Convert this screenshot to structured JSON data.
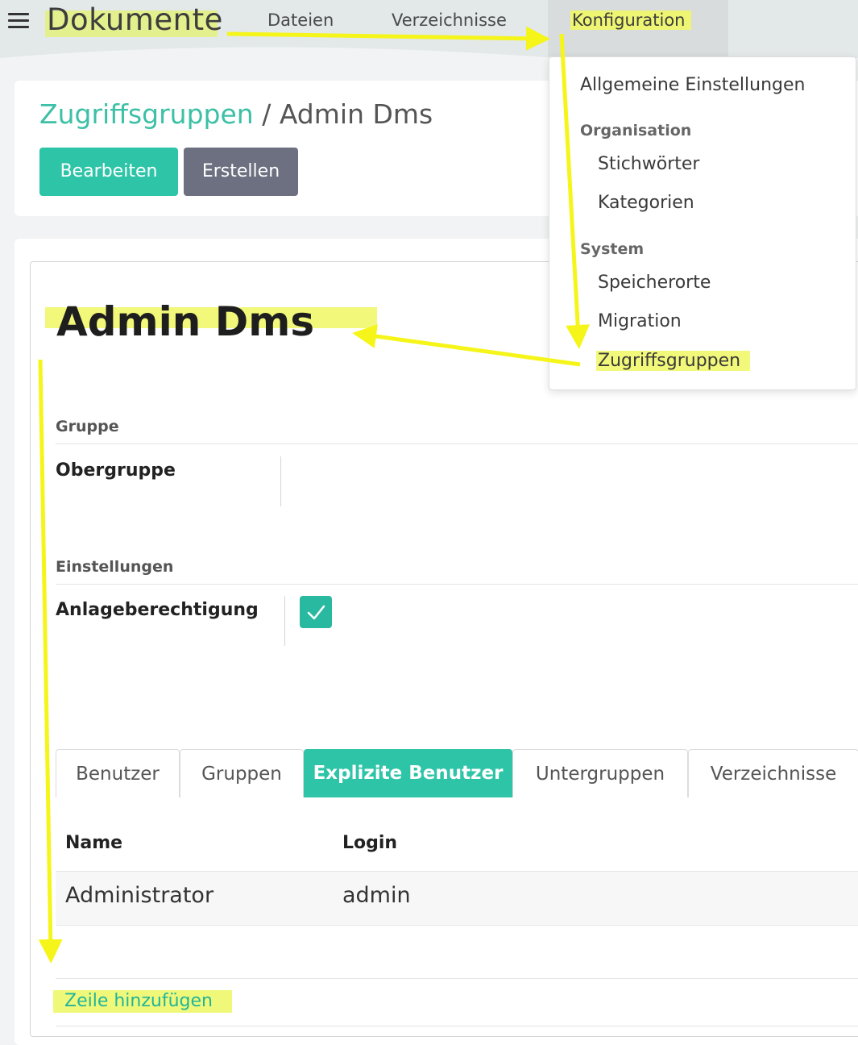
{
  "navbar": {
    "app_title": "Dokumente",
    "items": [
      "Dateien",
      "Verzeichnisse",
      "Konfiguration"
    ]
  },
  "dropdown": {
    "general": "Allgemeine Einstellungen",
    "section_org": "Organisation",
    "org_items": [
      "Stichwörter",
      "Kategorien"
    ],
    "section_system": "System",
    "system_items": [
      "Speicherorte",
      "Migration",
      "Zugriffsgruppen"
    ]
  },
  "breadcrumb": {
    "parent": "Zugriffsgruppen",
    "separator": "/",
    "current": "Admin Dms"
  },
  "buttons": {
    "edit": "Bearbeiten",
    "create": "Erstellen"
  },
  "record": {
    "title": "Admin Dms",
    "group_label": "Gruppe",
    "parent_group_label": "Obergruppe",
    "parent_group_value": "",
    "settings_label": "Einstellungen",
    "create_permission_label": "Anlageberechtigung",
    "create_permission_checked": true
  },
  "tabs": [
    "Benutzer",
    "Gruppen",
    "Explizite Benutzer",
    "Untergruppen",
    "Verzeichnisse"
  ],
  "active_tab": "Explizite Benutzer",
  "table": {
    "columns": [
      "Name",
      "Login"
    ],
    "rows": [
      {
        "name": "Administrator",
        "login": "admin"
      }
    ],
    "add_row": "Zeile hinzufügen"
  },
  "colors": {
    "accent": "#2ec4a7",
    "secondary_button": "#6d7080",
    "annotation_highlight": "#f2f87a",
    "annotation_arrow": "#f5f51a"
  }
}
